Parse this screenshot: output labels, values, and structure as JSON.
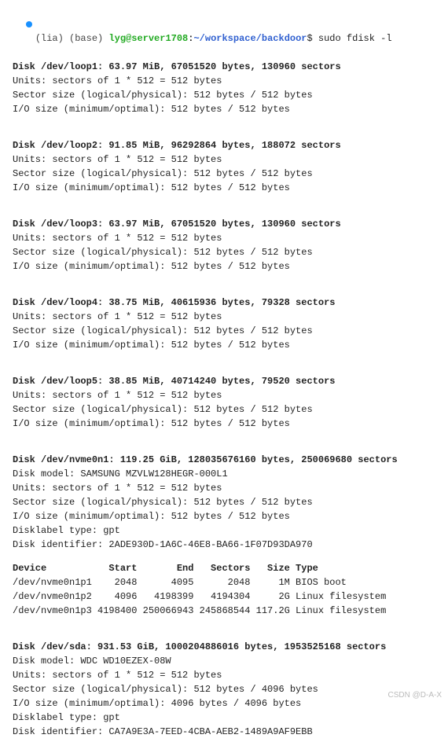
{
  "prompt": {
    "env": "(lia) (base) ",
    "user_host": "lyg@server1708",
    "colon": ":",
    "path": "~/workspace/backdoor",
    "dollar": "$ ",
    "command": "sudo fdisk -l"
  },
  "disks": [
    {
      "header": "Disk /dev/loop1: 63.97 MiB, 67051520 bytes, 130960 sectors",
      "lines": [
        "Units: sectors of 1 * 512 = 512 bytes",
        "Sector size (logical/physical): 512 bytes / 512 bytes",
        "I/O size (minimum/optimal): 512 bytes / 512 bytes"
      ]
    },
    {
      "header": "Disk /dev/loop2: 91.85 MiB, 96292864 bytes, 188072 sectors",
      "lines": [
        "Units: sectors of 1 * 512 = 512 bytes",
        "Sector size (logical/physical): 512 bytes / 512 bytes",
        "I/O size (minimum/optimal): 512 bytes / 512 bytes"
      ]
    },
    {
      "header": "Disk /dev/loop3: 63.97 MiB, 67051520 bytes, 130960 sectors",
      "lines": [
        "Units: sectors of 1 * 512 = 512 bytes",
        "Sector size (logical/physical): 512 bytes / 512 bytes",
        "I/O size (minimum/optimal): 512 bytes / 512 bytes"
      ]
    },
    {
      "header": "Disk /dev/loop4: 38.75 MiB, 40615936 bytes, 79328 sectors",
      "lines": [
        "Units: sectors of 1 * 512 = 512 bytes",
        "Sector size (logical/physical): 512 bytes / 512 bytes",
        "I/O size (minimum/optimal): 512 bytes / 512 bytes"
      ]
    },
    {
      "header": "Disk /dev/loop5: 38.85 MiB, 40714240 bytes, 79520 sectors",
      "lines": [
        "Units: sectors of 1 * 512 = 512 bytes",
        "Sector size (logical/physical): 512 bytes / 512 bytes",
        "I/O size (minimum/optimal): 512 bytes / 512 bytes"
      ]
    },
    {
      "header": "Disk /dev/nvme0n1: 119.25 GiB, 128035676160 bytes, 250069680 sectors",
      "lines": [
        "Disk model: SAMSUNG MZVLW128HEGR-000L1",
        "Units: sectors of 1 * 512 = 512 bytes",
        "Sector size (logical/physical): 512 bytes / 512 bytes",
        "I/O size (minimum/optimal): 512 bytes / 512 bytes",
        "Disklabel type: gpt",
        "Disk identifier: 2ADE930D-1A6C-46E8-BA66-1F07D93DA970"
      ]
    }
  ],
  "partition_table": {
    "header": "Device           Start       End   Sectors   Size Type",
    "rows": [
      "/dev/nvme0n1p1    2048      4095      2048     1M BIOS boot",
      "/dev/nvme0n1p2    4096   4198399   4194304     2G Linux filesystem",
      "/dev/nvme0n1p3 4198400 250066943 245868544 117.2G Linux filesystem"
    ]
  },
  "sda": {
    "header": "Disk /dev/sda: 931.53 GiB, 1000204886016 bytes, 1953525168 sectors",
    "lines": [
      "Disk model: WDC WD10EZEX-08W",
      "Units: sectors of 1 * 512 = 512 bytes",
      "Sector size (logical/physical): 512 bytes / 4096 bytes",
      "I/O size (minimum/optimal): 4096 bytes / 4096 bytes",
      "Disklabel type: gpt",
      "Disk identifier: CA7A9E3A-7EED-4CBA-AEB2-1489A9AF9EBB"
    ]
  },
  "watermark": "CSDN @D-A-X"
}
